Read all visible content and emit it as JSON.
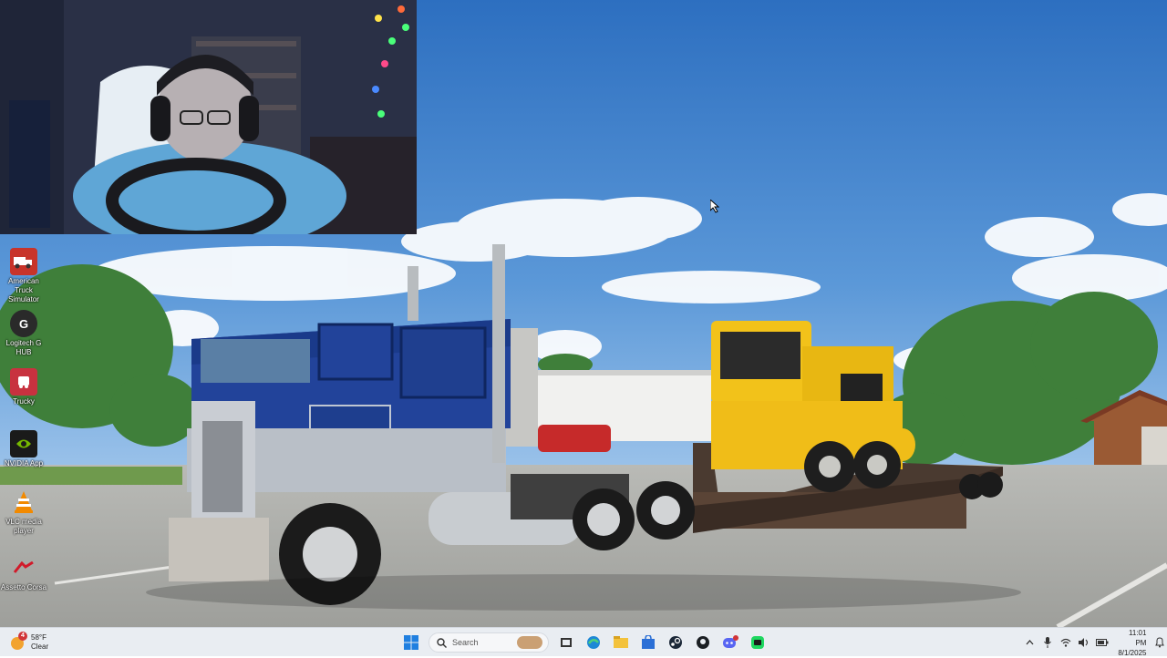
{
  "desktop": {
    "icons": [
      {
        "label": "American Truck Simulator",
        "icon": "truck-icon",
        "color": "#c8342a"
      },
      {
        "label": "Logitech G HUB",
        "icon": "logitech-g-icon",
        "color": "#2a2a2a"
      },
      {
        "label": "Trucky",
        "icon": "trucky-icon",
        "color": "#c8323f"
      },
      {
        "label": "NVIDIA App",
        "icon": "nvidia-icon",
        "color": "#1a1a1a"
      },
      {
        "label": "VLC media player",
        "icon": "vlc-cone-icon",
        "color": "#f28a00"
      },
      {
        "label": "Assetto Corsa",
        "icon": "assetto-corsa-icon",
        "color": "#d11a2a"
      }
    ]
  },
  "taskbar": {
    "weather": {
      "temp": "58°F",
      "condition": "Clear",
      "badge": "4"
    },
    "search_placeholder": "Search",
    "clock": {
      "time": "11:01 PM",
      "date": "8/1/2025"
    },
    "pinned": [
      "start-icon",
      "search",
      "task-view-icon",
      "edge-icon",
      "file-explorer-icon",
      "store-icon",
      "steam-icon",
      "github-icon",
      "discord-icon",
      "app-icon"
    ]
  },
  "colors": {
    "taskbar_bg": "#e9edf2",
    "sky": "#3f7fc8",
    "truck_blue": "#1f3f8f",
    "loader_yellow": "#f2c21a"
  }
}
